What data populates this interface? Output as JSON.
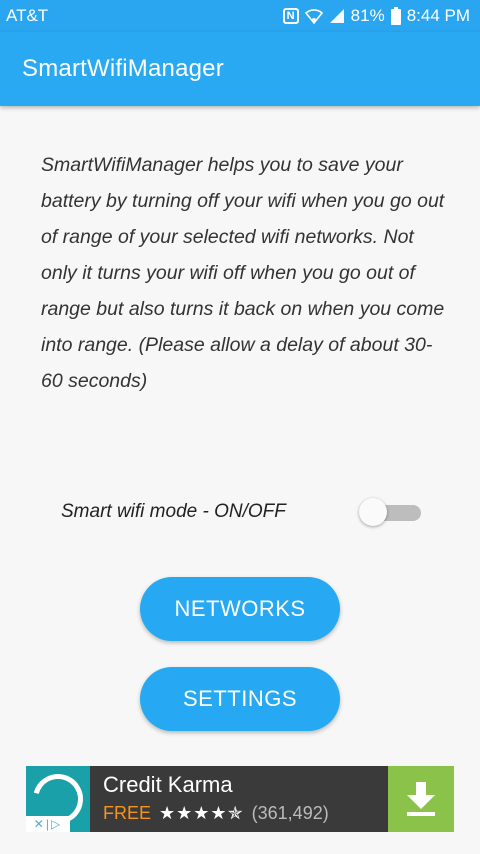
{
  "status_bar": {
    "carrier": "AT&T",
    "battery": "81%",
    "time": "8:44 PM"
  },
  "app_bar": {
    "title": "SmartWifiManager"
  },
  "main": {
    "description": "SmartWifiManager helps you to save your battery by turning off your wifi when you go out of range of your selected wifi networks. Not only it turns your wifi off when you go out of range but also turns it back on when you come into range. (Please allow a delay of about 30-60 seconds)",
    "toggle_label": "Smart wifi mode - ON/OFF",
    "toggle_on": false,
    "networks_label": "NETWORKS",
    "settings_label": "SETTINGS"
  },
  "ad": {
    "name": "Credit Karma",
    "price": "FREE",
    "stars": "★★★★✯",
    "rating_count": "(361,492)",
    "adchoices": "✕|▷"
  },
  "colors": {
    "primary": "#29a9f2",
    "button": "#26a9f2",
    "ad_download": "#8bc34a",
    "ad_free": "#f7941d"
  }
}
